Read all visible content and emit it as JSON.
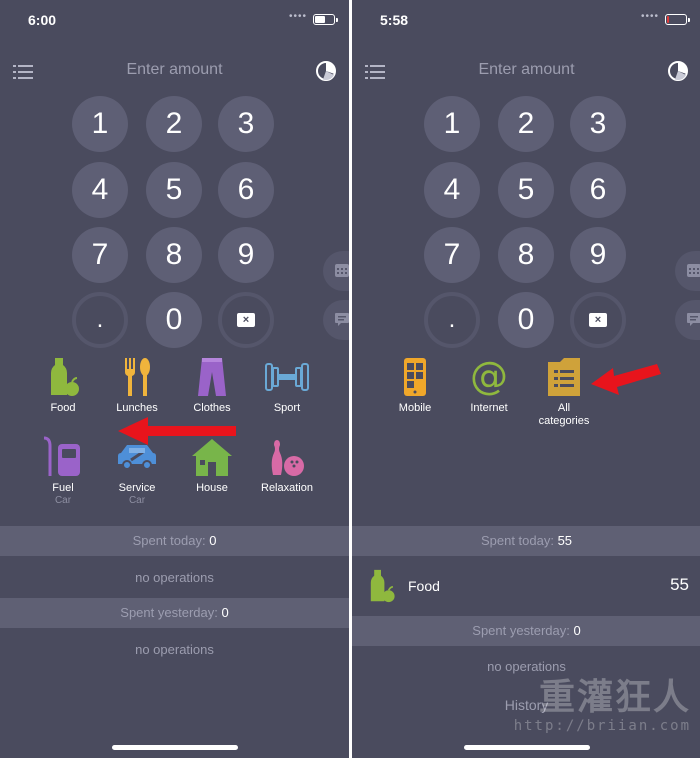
{
  "screens": [
    {
      "status_time": "6:00",
      "battery_level": 0.6,
      "battery_color": "#ffffff",
      "title": "Enter amount",
      "keypad": [
        "1",
        "2",
        "3",
        "4",
        "5",
        "6",
        "7",
        "8",
        "9",
        ".",
        "0",
        "×"
      ],
      "categories": [
        {
          "label": "Food",
          "sub": "",
          "icon": "bottle-apple-icon"
        },
        {
          "label": "Lunches",
          "sub": "",
          "icon": "fork-spoon-icon"
        },
        {
          "label": "Clothes",
          "sub": "",
          "icon": "trousers-icon"
        },
        {
          "label": "Sport",
          "sub": "",
          "icon": "dumbbell-icon"
        },
        {
          "label": "Fuel",
          "sub": "Car",
          "icon": "fuel-pump-icon"
        },
        {
          "label": "Service",
          "sub": "Car",
          "icon": "car-wrench-icon"
        },
        {
          "label": "House",
          "sub": "",
          "icon": "house-icon"
        },
        {
          "label": "Relaxation",
          "sub": "",
          "icon": "bowling-icon"
        }
      ],
      "page_index": 0,
      "page_count": 2,
      "spent_today_label": "Spent today:",
      "spent_today_value": "0",
      "today_ops_empty": "no operations",
      "spent_yesterday_label": "Spent yesterday:",
      "spent_yesterday_value": "0",
      "yesterday_ops_empty": "no operations"
    },
    {
      "status_time": "5:58",
      "battery_level": 0.1,
      "battery_color": "#e03a3a",
      "title": "Enter amount",
      "keypad": [
        "1",
        "2",
        "3",
        "4",
        "5",
        "6",
        "7",
        "8",
        "9",
        ".",
        "0",
        "×"
      ],
      "categories": [
        {
          "label": "Mobile",
          "sub": "",
          "icon": "mobile-phone-icon"
        },
        {
          "label": "Internet",
          "sub": "",
          "icon": "at-sign-icon"
        },
        {
          "label": "All categories",
          "sub": "",
          "icon": "list-folder-icon"
        }
      ],
      "page_index": 1,
      "page_count": 2,
      "spent_today_label": "Spent today:",
      "spent_today_value": "55",
      "today_ops": [
        {
          "category": "Food",
          "amount": "55",
          "icon": "bottle-apple-icon"
        }
      ],
      "spent_yesterday_label": "Spent yesterday:",
      "spent_yesterday_value": "0",
      "yesterday_ops_empty": "no operations",
      "history_label": "History"
    }
  ],
  "watermark": {
    "logo_text": "重灌狂人",
    "url": "http://briian.com"
  },
  "colors": {
    "background": "#4a4b5e",
    "key": "#5e5f75",
    "section": "#5f6074",
    "arrow": "#e8141c",
    "food_green": "#8fb83e",
    "lunch_yellow": "#f0b43c",
    "clothes_purple": "#9a63c9",
    "sport_blue": "#6aa9d6",
    "fuel_purple": "#9a63c9",
    "car_blue": "#4e8fd8",
    "house_green": "#78b54a",
    "relax_pink": "#d86aa6",
    "mobile_orange": "#f0a72a",
    "internet_green": "#8fb83e",
    "allcat_gold": "#cfa23a"
  }
}
